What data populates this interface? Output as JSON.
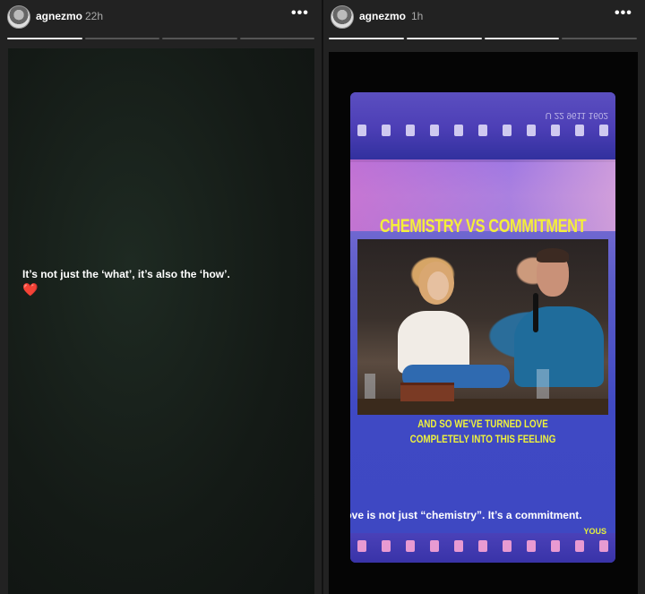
{
  "left_story": {
    "username": "agnezmo",
    "time": "22h",
    "more": "•••",
    "progress": {
      "done": 1,
      "total": 4
    },
    "caption": "It’s not just the ‘what’, it’s also the ‘how’.",
    "emoji": "❤️"
  },
  "right_story": {
    "username": "agnezmo",
    "time": "1h",
    "more": "•••",
    "progress": {
      "done": 3,
      "total": 4
    },
    "film_text": "U 22 9611 1602",
    "video_title": "CHEMISTRY VS COMMITMENT",
    "subtitle_lines": [
      "AND SO WE'VE TURNED LOVE",
      "COMPLETELY INTO THIS FEELING"
    ],
    "caption": "Love is not just “chemistry”. It’s a commitment.",
    "brand": "YOUS"
  },
  "colors": {
    "title_yellow": "#f4ee3a",
    "heart_red": "#e0313b",
    "video_blue": "#4a4bd6"
  }
}
